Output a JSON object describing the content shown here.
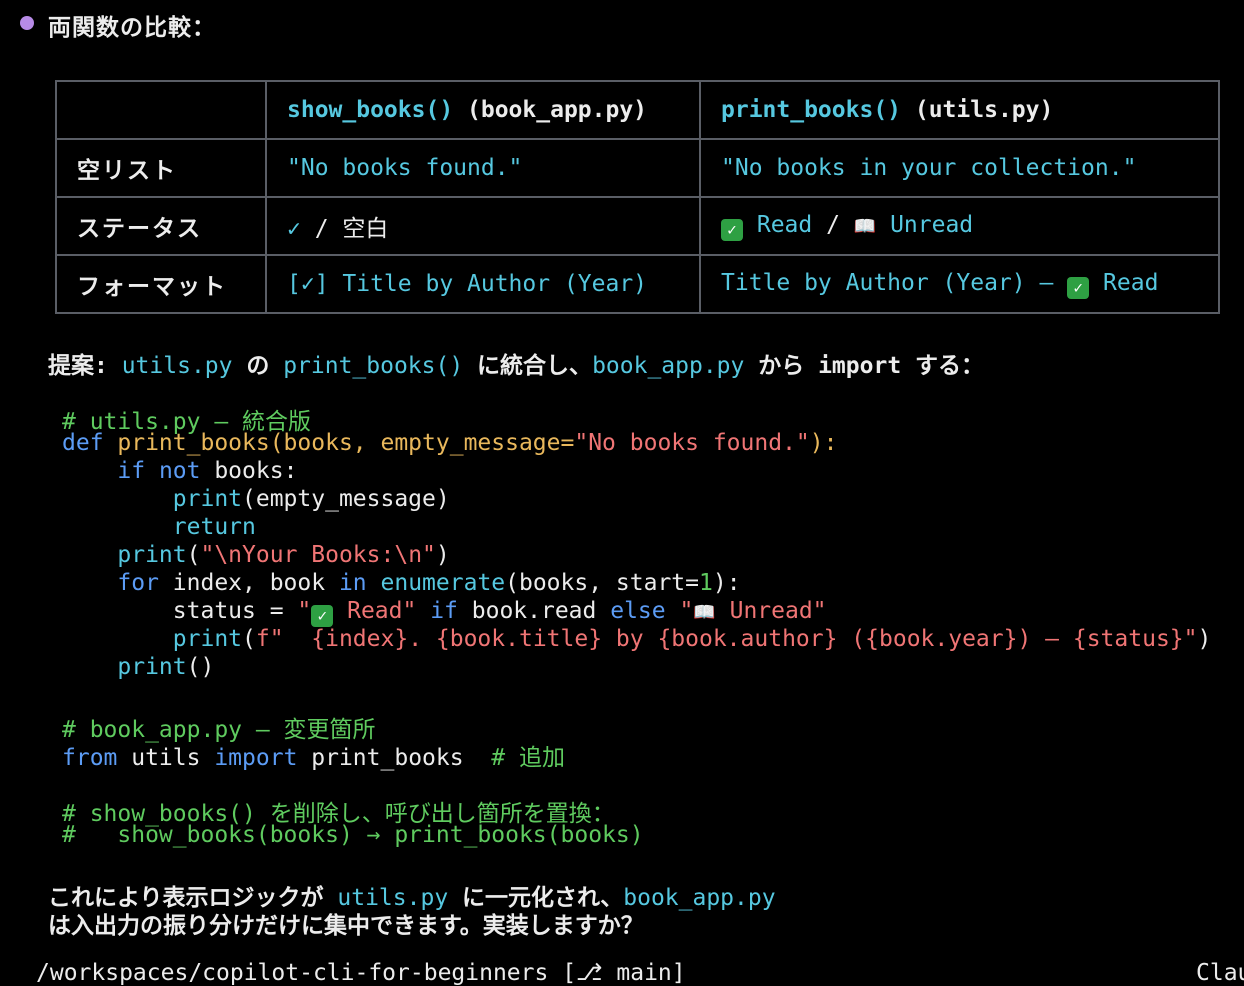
{
  "heading": "両関数の比較：",
  "table": {
    "header": {
      "empty": "",
      "col1_fn": "show_books()",
      "col1_file": " (book_app.py)",
      "col2_fn": "print_books()",
      "col2_file": " (utils.py)"
    },
    "rows": [
      {
        "label": "空リスト",
        "a": "\"No books found.\"",
        "b": "\"No books in your collection.\""
      },
      {
        "label": "ステータス",
        "a_check": "✓",
        "a_rest": " / 空白",
        "b_read": " Read",
        "b_sep": " / ",
        "b_unread": " Unread"
      },
      {
        "label": "フォーマット",
        "a": "[✓] Title by Author (Year)",
        "b_pre": "Title by Author (Year) — ",
        "b_read": " Read"
      }
    ]
  },
  "proposal": {
    "prefix": "提案: ",
    "f1": "utils.py",
    "t1": " の ",
    "f2": "print_books()",
    "t2": " に統合し、",
    "f3": "book_app.py",
    "t3": " から import する："
  },
  "code": {
    "c1": "# utils.py — 統合版",
    "l2_def": "def",
    "l2_sig": " print_books(books, empty_message=",
    "l2_str": "\"No books found.\"",
    "l2_end": "):",
    "l3_if": "    if",
    "l3_not": " not",
    "l3_rest": " books:",
    "l4_print": "        print",
    "l4_rest": "(empty_message)",
    "l5_return": "        return",
    "l6_print": "    print",
    "l6_p1": "(",
    "l6_str": "\"\\nYour Books:\\n\"",
    "l6_p2": ")",
    "l7_for": "    for",
    "l7_a": " index, book ",
    "l7_in": "in",
    "l7_b": " ",
    "l7_enum": "enumerate",
    "l7_c": "(books, start=",
    "l7_num": "1",
    "l7_d": "):",
    "l8_a": "        status = ",
    "l8_q1": "\"",
    "l8_read": " Read\"",
    "l8_if": " if",
    "l8_b": " book.read ",
    "l8_else": "else",
    "l8_q2": " \"",
    "l8_unread": " Unread\"",
    "l9_print": "        print",
    "l9_a": "(",
    "l9_str": "f\"  {index}. {book.title} by {book.author} ({book.year}) — {status}\"",
    "l9_b": ")",
    "l10_print": "    print",
    "l10_rest": "()",
    "c2": "# book_app.py — 変更箇所",
    "l12_from": "from",
    "l12_a": " utils ",
    "l12_import": "import",
    "l12_b": " print_books  ",
    "l12_cm": "# 追加",
    "c3": "# show_books() を削除し、呼び出し箇所を置換：",
    "c4": "#   show_books(books) → print_books(books)"
  },
  "conclusion": {
    "t1": "これにより表示ロジックが ",
    "f1": "utils.py",
    "t2": " に一元化され、",
    "f2": "book_app.py",
    "line2": "は入出力の振り分けだけに集中できます。実装しますか？"
  },
  "statusbar": {
    "path": "/workspaces/copilot-cli-for-beginners [⎇ main]",
    "right": "Clau"
  },
  "colors": {
    "background": "#000000",
    "accent_purple": "#B78BE6",
    "cyan": "#56C8E0",
    "green": "#5FCB5F",
    "keyword_blue": "#5C9CF5",
    "string_red": "#F07575",
    "function_orange": "#E9B85C",
    "border_gray": "#5A5E66"
  },
  "icons": {
    "check": "check-mark-icon",
    "check_box": "white-heavy-check-mark-icon",
    "book": "open-book-icon",
    "bullet": "bullet-dot-icon"
  }
}
